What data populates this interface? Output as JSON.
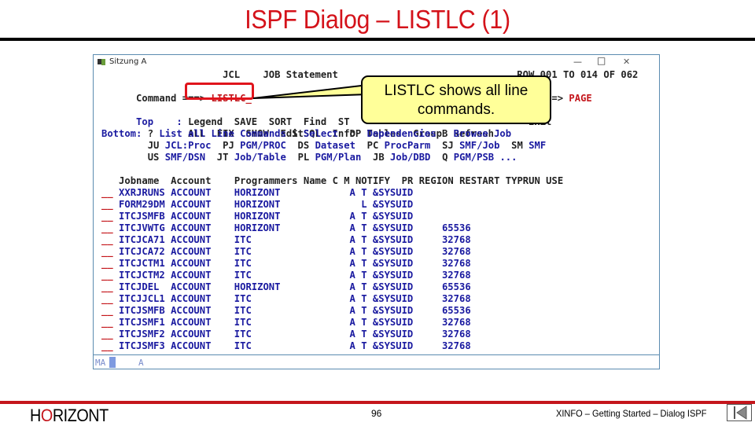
{
  "slide": {
    "title": "ISPF Dialog – LISTLC (1)",
    "footer": {
      "logo_pre": "H",
      "logo_o": "O",
      "logo_post": "RIZONT",
      "page_number": "96",
      "course_title": "XINFO – Getting Started – Dialog ISPF"
    }
  },
  "window": {
    "title": "Sitzung A",
    "controls": {
      "minimize": "—",
      "maximize": "□",
      "close": "✕"
    }
  },
  "screen": {
    "header_line": "                     JCL    JOB Statement                               ROW 001 TO 014 OF 062",
    "command_label": "Command ===>",
    "command_value": "LISTLC_",
    "scroll_label": "SCROLL ===>",
    "scroll_value": "PAGE",
    "top_label": "Top    :",
    "top_commands_1": "Legend  SAVE  SORT  Find  ST                               Exit",
    "top_commands_2": "ALL  FIX  SHOW  EditSQL  Info  Tables  Group  Refresh",
    "bottom_label": "Bottom:",
    "bottom_line_1": [
      {
        "code": "?",
        "text": "List all Line Commands"
      },
      {
        "code": "S",
        "text": "Select"
      },
      {
        "code": "DP",
        "text": "Dependencies"
      },
      {
        "code": "B",
        "text": "Browse Job"
      }
    ],
    "bottom_line_2": [
      {
        "code": "JU",
        "text": "JCL:Proc"
      },
      {
        "code": "PJ",
        "text": "PGM/PROC"
      },
      {
        "code": "DS",
        "text": "Dataset"
      },
      {
        "code": "PC",
        "text": "ProcParm"
      },
      {
        "code": "SJ",
        "text": "SMF/Job"
      },
      {
        "code": "SM",
        "text": "SMF"
      }
    ],
    "bottom_line_3": [
      {
        "code": "US",
        "text": "SMF/DSN"
      },
      {
        "code": "JT",
        "text": "Job/Table"
      },
      {
        "code": "PL",
        "text": "PGM/Plan"
      },
      {
        "code": "JB",
        "text": "Job/DBD"
      },
      {
        "code": "Q",
        "text": "PGM/PSB ..."
      }
    ],
    "table": {
      "columns": [
        "Jobname",
        "Account",
        "Programmers Name",
        "C",
        "M",
        "NOTIFY",
        "PR",
        "REGION",
        "RESTART",
        "TYPRUN",
        "USE"
      ],
      "rows": [
        {
          "cmd": "__",
          "jobname": "XXRJRUNS",
          "account": "ACCOUNT",
          "programmer": "HORIZONT",
          "c": "A",
          "m": "T",
          "notify": "&SYSUID",
          "region": ""
        },
        {
          "cmd": "__",
          "jobname": "FORM29DM",
          "account": "ACCOUNT",
          "programmer": "HORIZONT",
          "c": "",
          "m": "L",
          "notify": "&SYSUID",
          "region": ""
        },
        {
          "cmd": "__",
          "jobname": "ITCJSMFB",
          "account": "ACCOUNT",
          "programmer": "HORIZONT",
          "c": "A",
          "m": "T",
          "notify": "&SYSUID",
          "region": ""
        },
        {
          "cmd": "__",
          "jobname": "ITCJVWTG",
          "account": "ACCOUNT",
          "programmer": "HORIZONT",
          "c": "A",
          "m": "T",
          "notify": "&SYSUID",
          "region": "65536"
        },
        {
          "cmd": "__",
          "jobname": "ITCJCA71",
          "account": "ACCOUNT",
          "programmer": "ITC",
          "c": "A",
          "m": "T",
          "notify": "&SYSUID",
          "region": "32768"
        },
        {
          "cmd": "__",
          "jobname": "ITCJCA72",
          "account": "ACCOUNT",
          "programmer": "ITC",
          "c": "A",
          "m": "T",
          "notify": "&SYSUID",
          "region": "32768"
        },
        {
          "cmd": "__",
          "jobname": "ITCJCTM1",
          "account": "ACCOUNT",
          "programmer": "ITC",
          "c": "A",
          "m": "T",
          "notify": "&SYSUID",
          "region": "32768"
        },
        {
          "cmd": "__",
          "jobname": "ITCJCTM2",
          "account": "ACCOUNT",
          "programmer": "ITC",
          "c": "A",
          "m": "T",
          "notify": "&SYSUID",
          "region": "32768"
        },
        {
          "cmd": "__",
          "jobname": "ITCJDEL",
          "account": "ACCOUNT",
          "programmer": "HORIZONT",
          "c": "A",
          "m": "T",
          "notify": "&SYSUID",
          "region": "65536"
        },
        {
          "cmd": "__",
          "jobname": "ITCJJCL1",
          "account": "ACCOUNT",
          "programmer": "ITC",
          "c": "A",
          "m": "T",
          "notify": "&SYSUID",
          "region": "32768"
        },
        {
          "cmd": "__",
          "jobname": "ITCJSMFB",
          "account": "ACCOUNT",
          "programmer": "ITC",
          "c": "A",
          "m": "T",
          "notify": "&SYSUID",
          "region": "65536"
        },
        {
          "cmd": "__",
          "jobname": "ITCJSMF1",
          "account": "ACCOUNT",
          "programmer": "ITC",
          "c": "A",
          "m": "T",
          "notify": "&SYSUID",
          "region": "32768"
        },
        {
          "cmd": "__",
          "jobname": "ITCJSMF2",
          "account": "ACCOUNT",
          "programmer": "ITC",
          "c": "A",
          "m": "T",
          "notify": "&SYSUID",
          "region": "32768"
        },
        {
          "cmd": "__",
          "jobname": "ITCJSMF3",
          "account": "ACCOUNT",
          "programmer": "ITC",
          "c": "A",
          "m": "T",
          "notify": "&SYSUID",
          "region": "32768"
        }
      ]
    },
    "status": {
      "mode": "MA",
      "indicator": "A"
    }
  },
  "callout": {
    "line1": "LISTLC shows all line",
    "line2": "commands."
  },
  "colors": {
    "title_red": "#d4121a",
    "terminal_blue": "#1a1aa0",
    "terminal_red": "#c4161c",
    "callout_yellow": "#ffff99"
  }
}
